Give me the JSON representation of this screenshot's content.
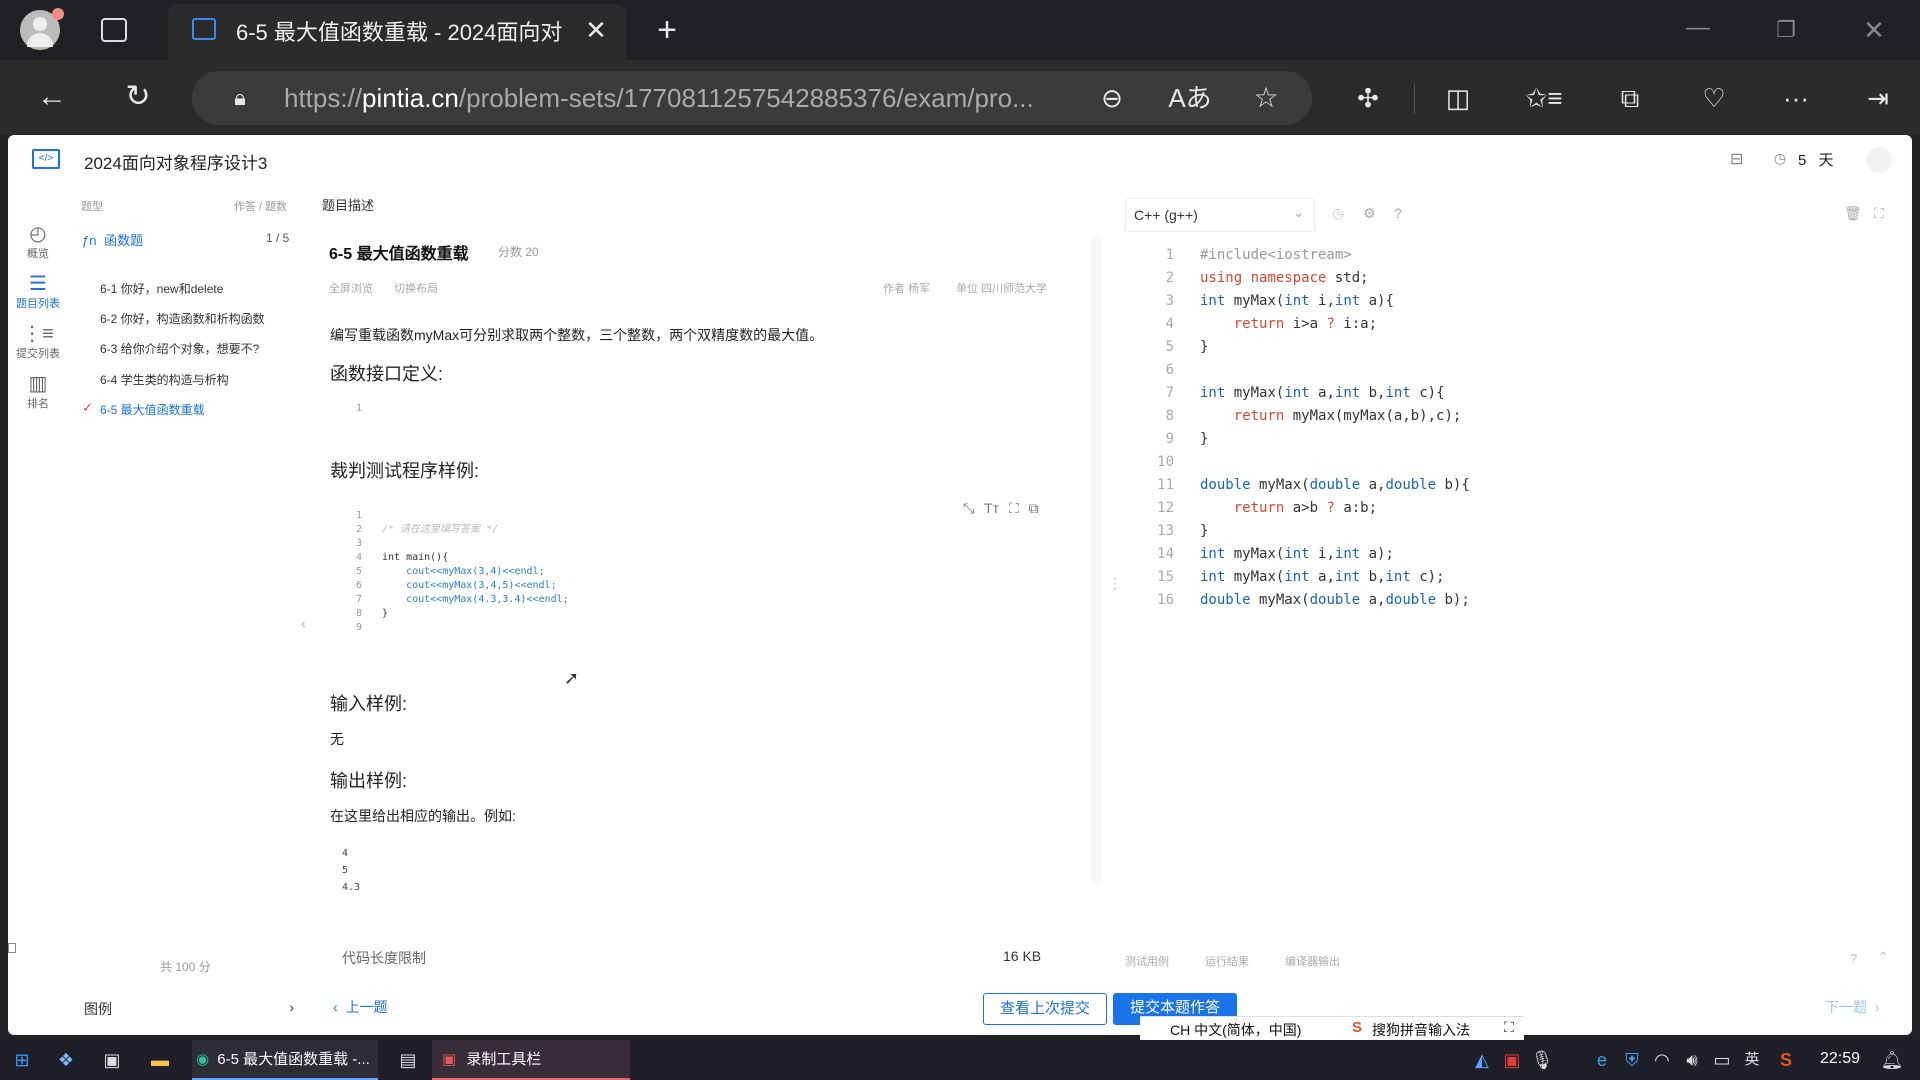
{
  "browser": {
    "tab_title": "6-5 最大值函数重载 - 2024面向对",
    "url_prefix": "https://",
    "url_domain": "pintia.cn",
    "url_rest": "/problem-sets/1770811257542885376/exam/pro..."
  },
  "header": {
    "course_title": "2024面向对象程序设计3",
    "days_value": "5",
    "days_unit": "天"
  },
  "rail": [
    {
      "icon": "dashboard-icon",
      "label": "概览"
    },
    {
      "icon": "list-icon",
      "label": "题目列表"
    },
    {
      "icon": "submissions-icon",
      "label": "提交列表"
    },
    {
      "icon": "ranking-icon",
      "label": "排名"
    }
  ],
  "sidebar": {
    "col_type": "题型",
    "col_progress": "作答 / 题数",
    "group_label": "函数题",
    "group_count": "1 / 5",
    "problems": [
      "6-1 你好，new和delete",
      "6-2 你好，构造函数和析构函数",
      "6-3 给你介绍个对象，想要不?",
      "6-4 学生类的构造与析构",
      "6-5 最大值函数重载"
    ],
    "total": "共 100 分",
    "legend": "图例"
  },
  "problem": {
    "section_label": "题目描述",
    "title": "6-5 最大值函数重载",
    "score": "分数 20",
    "fullscreen": "全屏浏览",
    "switch_layout": "切换布局",
    "author": "作者 杨军",
    "unit": "单位 四川师范大学",
    "description": "编写重载函数myMax可分别求取两个整数，三个整数，两个双精度数的最大值。",
    "interface_heading": "函数接口定义:",
    "interface_lines": [
      "1"
    ],
    "judge_heading": "裁判测试程序样例:",
    "judge_lines": [
      {
        "n": "1",
        "t": ""
      },
      {
        "n": "2",
        "t": "/* 请在这里填写答案 */"
      },
      {
        "n": "3",
        "t": ""
      },
      {
        "n": "4",
        "t": "int main(){"
      },
      {
        "n": "5",
        "t": "    cout<<myMax(3,4)<<endl;"
      },
      {
        "n": "6",
        "t": "    cout<<myMax(3,4,5)<<endl;"
      },
      {
        "n": "7",
        "t": "    cout<<myMax(4.3,3.4)<<endl;"
      },
      {
        "n": "8",
        "t": "}"
      },
      {
        "n": "9",
        "t": ""
      }
    ],
    "input_heading": "输入样例:",
    "input_text": "无",
    "output_heading": "输出样例:",
    "output_intro": "在这里给出相应的输出。例如:",
    "output_lines": [
      "4",
      "5",
      "4.3"
    ],
    "code_limit_label": "代码长度限制",
    "code_limit_value": "16 KB"
  },
  "editor": {
    "language": "C++ (g++)",
    "lines": [
      "#include<iostream>",
      "using namespace std;",
      "int myMax(int i,int a){",
      "    return i>a ? i:a;",
      "}",
      "",
      "int myMax(int a,int b,int c){",
      "    return myMax(myMax(a,b),c);",
      "}",
      "",
      "double myMax(double a,double b){",
      "    return a>b ? a:b;",
      "}",
      "int myMax(int i,int a);",
      "int myMax(int a,int b,int c);",
      "double myMax(double a,double b);"
    ],
    "tabs": [
      "测试用例",
      "运行结果",
      "编译器输出"
    ]
  },
  "footer": {
    "prev": "上一题",
    "view_last": "查看上次提交",
    "submit": "提交本题作答",
    "next": "下一题"
  },
  "ime": {
    "lang": "CH 中文(简体，中国)",
    "name": "搜狗拼音输入法"
  },
  "taskbar": {
    "edge_task": "6-5 最大值函数重载 -...",
    "recorder_task": "录制工具栏",
    "ime_char": "英",
    "clock": "22:59"
  }
}
